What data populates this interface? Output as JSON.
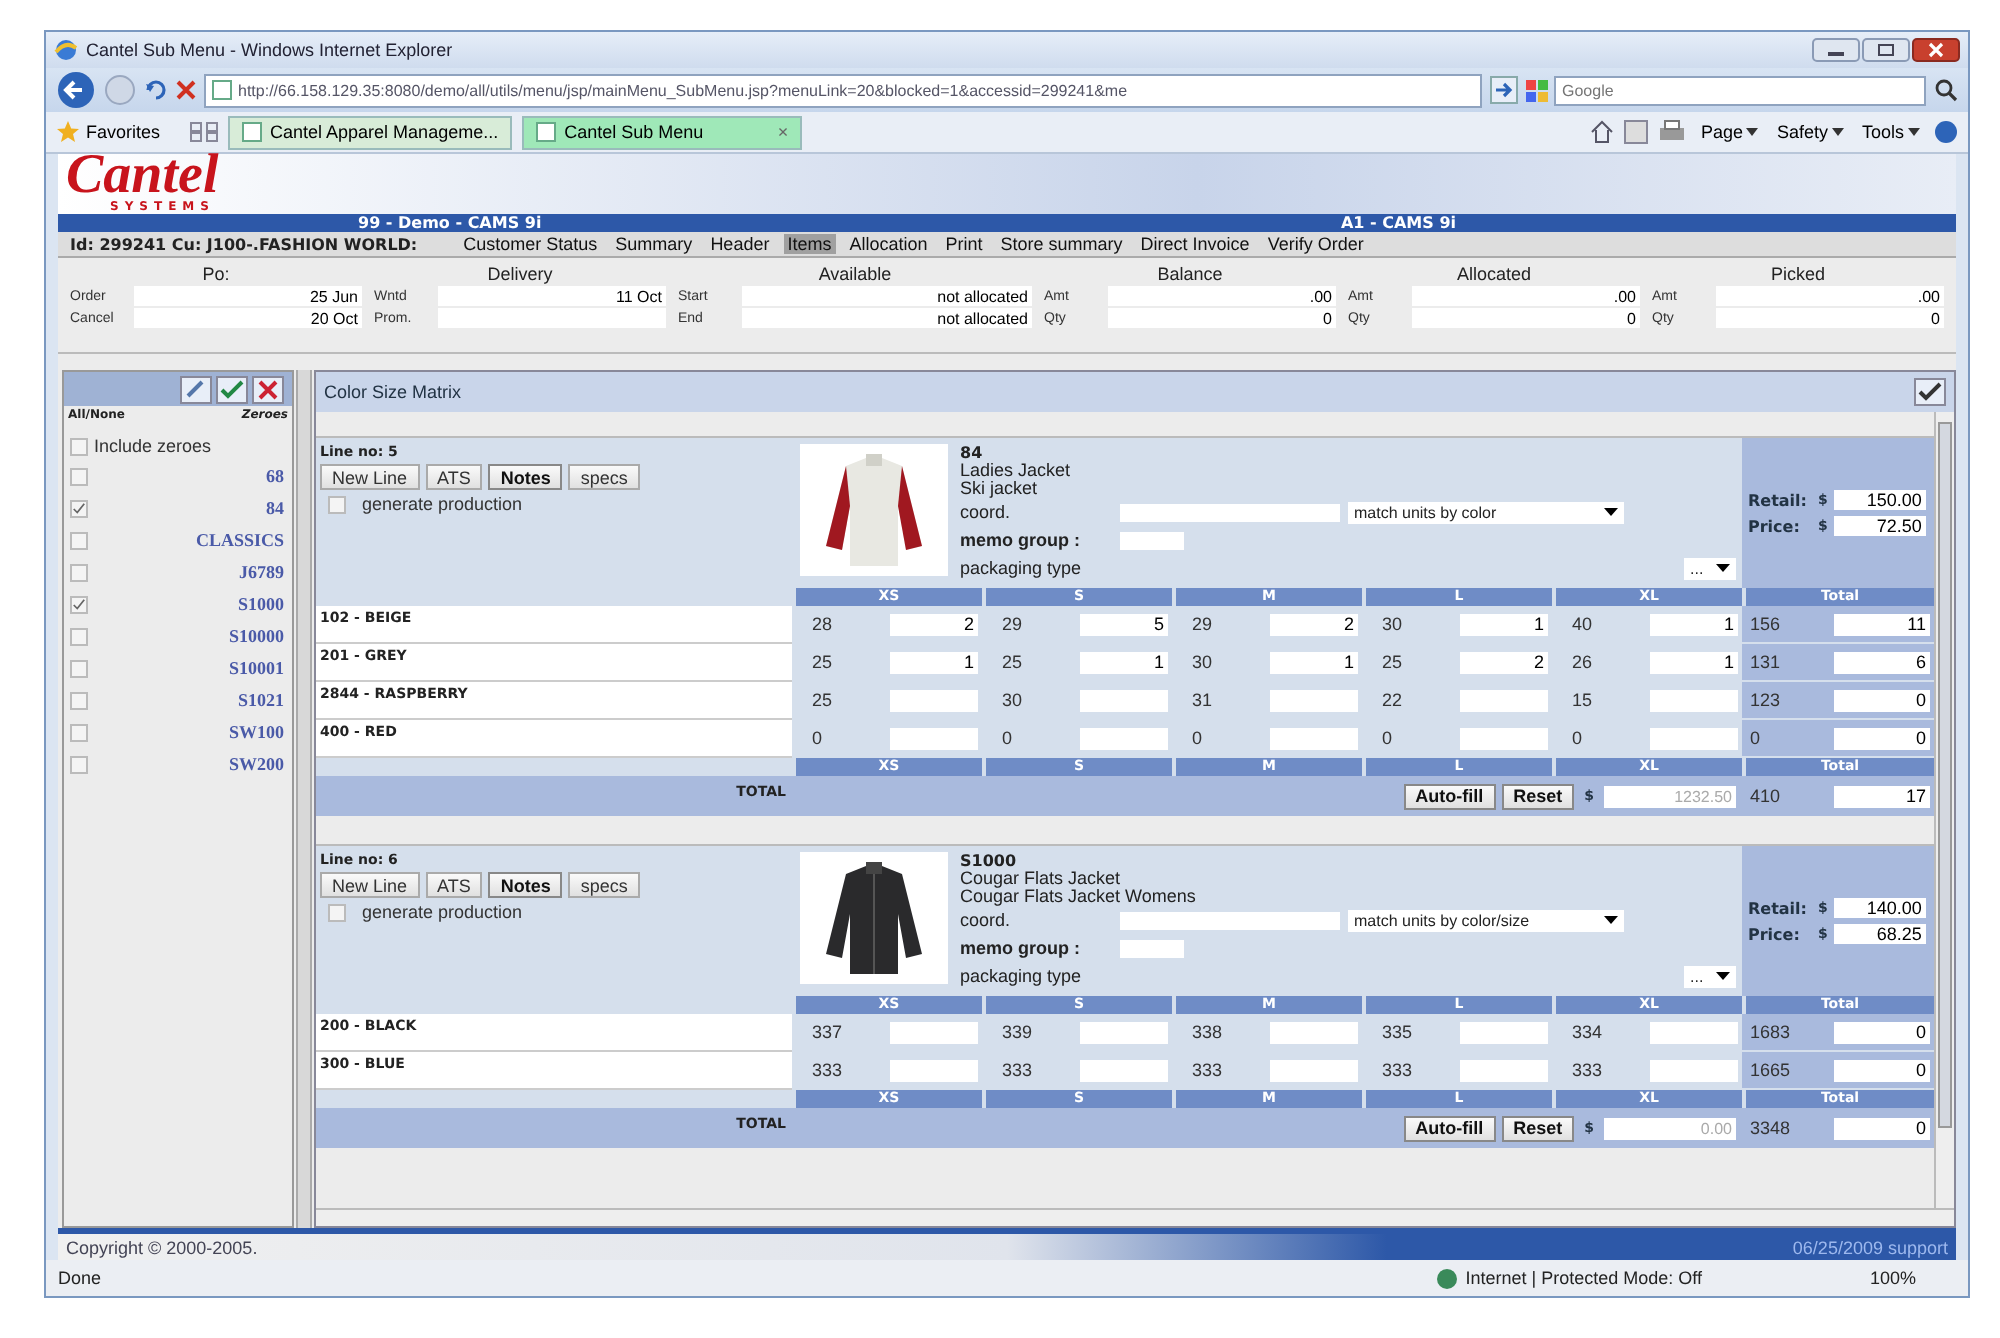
{
  "window": {
    "title": "Cantel Sub Menu - Windows Internet Explorer"
  },
  "browser": {
    "url": "http://66.158.129.35:8080/demo/all/utils/menu/jsp/mainMenu_SubMenu.jsp?menuLink=20&blocked=1&accessid=299241&me",
    "search_placeholder": "Google",
    "favorites": "Favorites",
    "tab_close": "×",
    "tabs": [
      {
        "label": "Cantel Apparel Manageme...",
        "selected": false
      },
      {
        "label": "Cantel Sub Menu",
        "selected": true
      }
    ],
    "tools": [
      "Page",
      "Safety",
      "Tools"
    ]
  },
  "app": {
    "logo": "Cantel",
    "logo_sub": "SYSTEMS",
    "header_left": "99 - Demo - CAMS 9i",
    "header_right": "A1 - CAMS 9i",
    "customer": "Id: 299241 Cu: J100-.FASHION WORLD:",
    "nav": [
      {
        "label": "Customer Status",
        "selected": false
      },
      {
        "label": "Summary",
        "selected": false
      },
      {
        "label": "Header",
        "selected": false
      },
      {
        "label": "Items",
        "selected": true
      },
      {
        "label": "Allocation",
        "selected": false
      },
      {
        "label": "Print",
        "selected": false
      },
      {
        "label": "Store summary",
        "selected": false
      },
      {
        "label": "Direct Invoice",
        "selected": false
      },
      {
        "label": "Verify Order",
        "selected": false
      }
    ]
  },
  "summary": [
    {
      "title": "Po:",
      "fields": [
        {
          "label": "Order",
          "value": "25 Jun"
        },
        {
          "label": "Cancel",
          "value": "20 Oct"
        }
      ]
    },
    {
      "title": "Delivery",
      "fields": [
        {
          "label": "Wntd",
          "value": "11 Oct"
        },
        {
          "label": "Prom."
        }
      ]
    },
    {
      "title": "Available",
      "fields": [
        {
          "label": "Start",
          "value": "not allocated"
        },
        {
          "label": "End",
          "value": "not allocated"
        }
      ]
    },
    {
      "title": "Balance",
      "fields": [
        {
          "label": "Amt",
          "value": ".00"
        },
        {
          "label": "Qty",
          "value": "0"
        }
      ]
    },
    {
      "title": "Allocated",
      "fields": [
        {
          "label": "Amt",
          "value": ".00"
        },
        {
          "label": "Qty",
          "value": "0"
        }
      ]
    },
    {
      "title": "Picked",
      "fields": [
        {
          "label": "Amt",
          "value": ".00"
        },
        {
          "label": "Qty",
          "value": "0"
        }
      ]
    }
  ],
  "sidebar": {
    "all_none": "All/None",
    "zeroes": "Zeroes",
    "include_zeroes": {
      "label": "Include zeroes",
      "checked": false
    },
    "items": [
      {
        "label": "68",
        "checked": false
      },
      {
        "label": "84",
        "checked": true
      },
      {
        "label": "CLASSICS",
        "checked": false
      },
      {
        "label": "J6789",
        "checked": false
      },
      {
        "label": "S1000",
        "checked": true
      },
      {
        "label": "S10000",
        "checked": false
      },
      {
        "label": "S10001",
        "checked": false
      },
      {
        "label": "S1021",
        "checked": false
      },
      {
        "label": "SW100",
        "checked": false
      },
      {
        "label": "SW200",
        "checked": false
      }
    ]
  },
  "matrix": {
    "title": "Color Size Matrix",
    "lines": [
      {
        "line_no": "Line no: 5",
        "buttons": [
          {
            "label": "New Line",
            "emphasized": false
          },
          {
            "label": "ATS",
            "emphasized": false
          },
          {
            "label": "Notes",
            "emphasized": true
          },
          {
            "label": "specs",
            "emphasized": false
          }
        ],
        "generate_production": {
          "label": "generate production",
          "checked": false
        },
        "style": "84",
        "description": [
          "Ladies Jacket",
          "Ski jacket"
        ],
        "coord_label": "coord.",
        "match": "match units by color",
        "memo_label": "memo group :",
        "packaging_label": "packaging type",
        "packaging": "...",
        "retail_label": "Retail:",
        "retail_currency": "$",
        "retail": "150.00",
        "price_label": "Price:",
        "price_currency": "$",
        "price": "72.50",
        "sizes_top": [
          "XS",
          "S",
          "M",
          "L",
          "XL"
        ],
        "total_top": "Total",
        "rows": [
          {
            "color_name": "102 - BEIGE",
            "cells": [
              {
                "avail": "28",
                "qty": "2"
              },
              {
                "avail": "29",
                "qty": "5"
              },
              {
                "avail": "29",
                "qty": "2"
              },
              {
                "avail": "30",
                "qty": "1"
              },
              {
                "avail": "40",
                "qty": "1"
              }
            ],
            "total_avail": "156",
            "total_qty": "11"
          },
          {
            "color_name": "201 - GREY",
            "cells": [
              {
                "avail": "25",
                "qty": "1"
              },
              {
                "avail": "25",
                "qty": "1"
              },
              {
                "avail": "30",
                "qty": "1"
              },
              {
                "avail": "25",
                "qty": "2"
              },
              {
                "avail": "26",
                "qty": "1"
              }
            ],
            "total_avail": "131",
            "total_qty": "6"
          },
          {
            "color_name": "2844 - RASPBERRY",
            "cells": [
              {
                "avail": "25"
              },
              {
                "avail": "30"
              },
              {
                "avail": "31"
              },
              {
                "avail": "22"
              },
              {
                "avail": "15"
              }
            ],
            "total_avail": "123",
            "total_qty": "0"
          },
          {
            "color_name": "400 - RED",
            "cells": [
              {
                "avail": "0"
              },
              {
                "avail": "0"
              },
              {
                "avail": "0"
              },
              {
                "avail": "0"
              },
              {
                "avail": "0"
              }
            ],
            "total_avail": "0",
            "total_qty": "0"
          }
        ],
        "sizes_bottom": [
          "XS",
          "S",
          "M",
          "L",
          "XL"
        ],
        "total_bottom": "Total",
        "total_label": "TOTAL",
        "autofill": "Auto-fill",
        "reset": "Reset",
        "amount_currency": "$",
        "amount": "1232.50",
        "sum_avail": "410",
        "sum_qty": "17"
      },
      {
        "line_no": "Line no: 6",
        "buttons": [
          {
            "label": "New Line",
            "emphasized": false
          },
          {
            "label": "ATS",
            "emphasized": false
          },
          {
            "label": "Notes",
            "emphasized": true
          },
          {
            "label": "specs",
            "emphasized": false
          }
        ],
        "generate_production": {
          "label": "generate production",
          "checked": false
        },
        "style": "S1000",
        "description": [
          "Cougar Flats Jacket",
          "Cougar Flats Jacket Womens"
        ],
        "coord_label": "coord.",
        "match": "match units by color/size",
        "memo_label": "memo group :",
        "packaging_label": "packaging type",
        "packaging": "...",
        "retail_label": "Retail:",
        "retail_currency": "$",
        "retail": "140.00",
        "price_label": "Price:",
        "price_currency": "$",
        "price": "68.25",
        "sizes_top": [
          "XS",
          "S",
          "M",
          "L",
          "XL"
        ],
        "total_top": "Total",
        "rows": [
          {
            "color_name": "200 - BLACK",
            "cells": [
              {
                "avail": "337"
              },
              {
                "avail": "339"
              },
              {
                "avail": "338"
              },
              {
                "avail": "335"
              },
              {
                "avail": "334"
              }
            ],
            "total_avail": "1683",
            "total_qty": "0"
          },
          {
            "color_name": "300 - BLUE",
            "cells": [
              {
                "avail": "333"
              },
              {
                "avail": "333"
              },
              {
                "avail": "333"
              },
              {
                "avail": "333"
              },
              {
                "avail": "333"
              }
            ],
            "total_avail": "1665",
            "total_qty": "0"
          }
        ],
        "sizes_bottom": [
          "XS",
          "S",
          "M",
          "L",
          "XL"
        ],
        "total_bottom": "Total",
        "total_label": "TOTAL",
        "autofill": "Auto-fill",
        "reset": "Reset",
        "amount_currency": "$",
        "amount": "0.00",
        "sum_avail": "3348",
        "sum_qty": "0"
      }
    ]
  },
  "footer": {
    "copyright": "Copyright © 2000-2005.",
    "date": "06/25/2009 support"
  },
  "status_bar": {
    "text": "Done",
    "zone": "Internet | Protected Mode: Off",
    "zoom": "100%"
  }
}
